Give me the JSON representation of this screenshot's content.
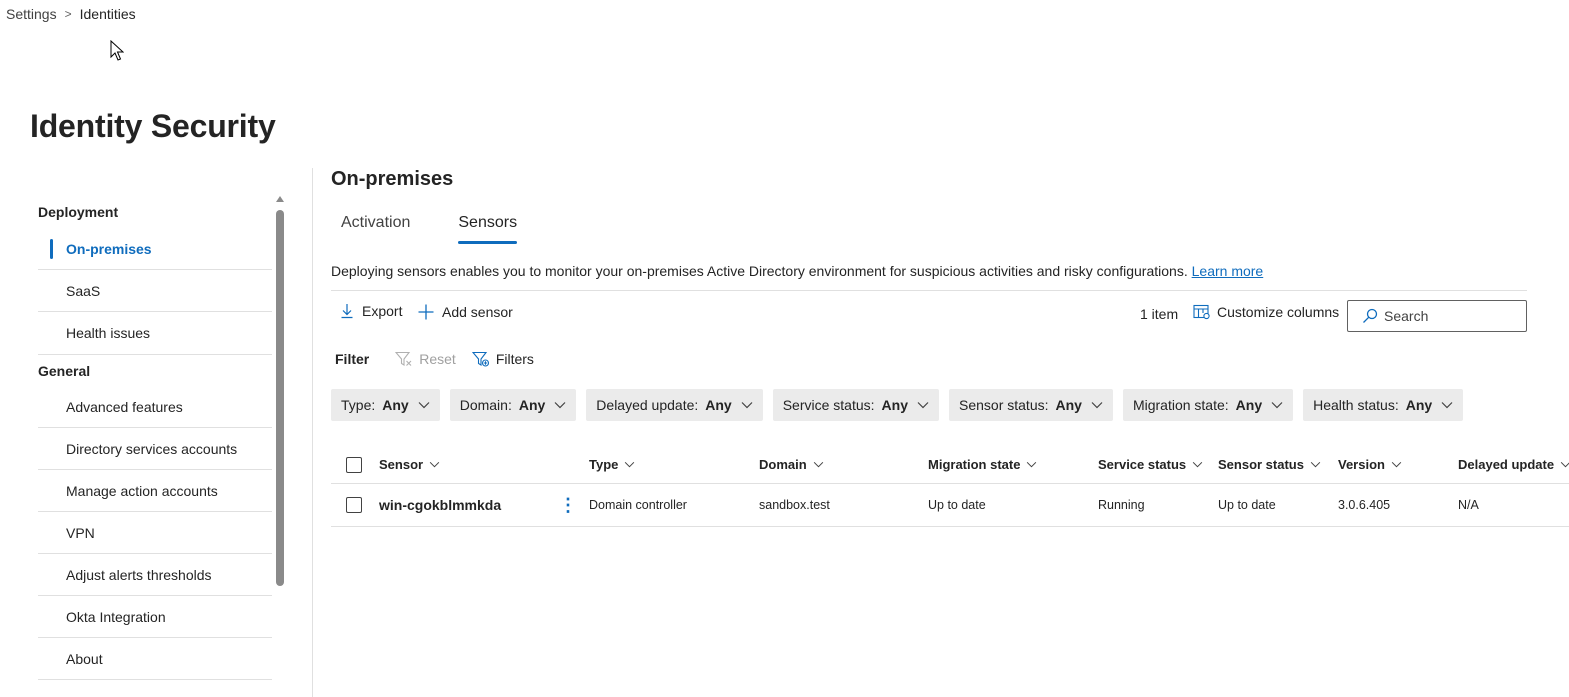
{
  "breadcrumb": {
    "items": [
      "Settings",
      "Identities"
    ]
  },
  "page": {
    "title": "Identity Security"
  },
  "sidebar": {
    "sections": [
      {
        "title": "Deployment",
        "items": [
          "On-premises",
          "SaaS",
          "Health issues"
        ]
      },
      {
        "title": "General",
        "items": [
          "Advanced features",
          "Directory services accounts",
          "Manage action accounts",
          "VPN",
          "Adjust alerts thresholds",
          "Okta Integration",
          "About"
        ]
      }
    ],
    "active_item": "On-premises"
  },
  "main": {
    "section_title": "On-premises",
    "tabs": [
      {
        "label": "Activation"
      },
      {
        "label": "Sensors"
      }
    ],
    "active_tab": "Sensors",
    "description": "Deploying sensors enables you to monitor your on-premises Active Directory environment for suspicious activities and risky configurations.",
    "learn_more": "Learn more"
  },
  "toolbar": {
    "export_label": "Export",
    "add_sensor_label": "Add sensor",
    "item_count": "1 item",
    "customize_columns_label": "Customize columns",
    "search_placeholder": "Search"
  },
  "filters": {
    "label": "Filter",
    "reset_label": "Reset",
    "filters_label": "Filters",
    "chips": [
      {
        "name": "Type:",
        "value": "Any"
      },
      {
        "name": "Domain:",
        "value": "Any"
      },
      {
        "name": "Delayed update:",
        "value": "Any"
      },
      {
        "name": "Service status:",
        "value": "Any"
      },
      {
        "name": "Sensor status:",
        "value": "Any"
      },
      {
        "name": "Migration state:",
        "value": "Any"
      },
      {
        "name": "Health status:",
        "value": "Any"
      }
    ]
  },
  "table": {
    "columns": [
      "Sensor",
      "Type",
      "Domain",
      "Migration state",
      "Service status",
      "Sensor status",
      "Version",
      "Delayed update"
    ],
    "rows": [
      {
        "sensor": "win-cgokblmmkda",
        "type": "Domain controller",
        "domain": "sandbox.test",
        "migration_state": "Up to date",
        "service_status": "Running",
        "sensor_status": "Up to date",
        "version": "3.0.6.405",
        "delayed_update": "N/A"
      }
    ]
  },
  "colors": {
    "accent": "#0f6cbd",
    "chip_bg": "#ebebeb",
    "divider": "#e0e0e0"
  }
}
